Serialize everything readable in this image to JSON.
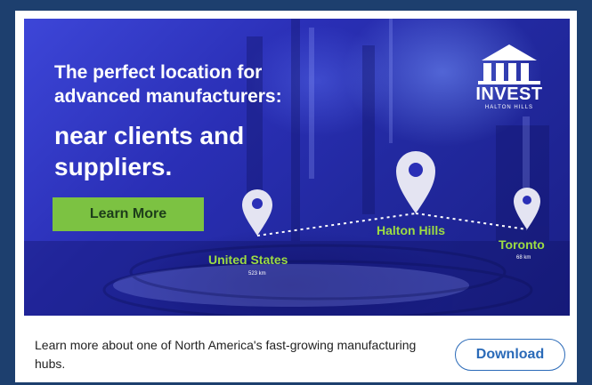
{
  "ad": {
    "headline_line1": "The perfect location for",
    "headline_line2": "advanced manufacturers:",
    "headline_big_line1": "near clients and",
    "headline_big_line2": "suppliers.",
    "learn_more_label": "Learn More",
    "logo_text": "INVEST",
    "logo_subtext": "HALTON HILLS",
    "locations": [
      {
        "name": "United States",
        "distance": "523 km"
      },
      {
        "name": "Halton Hills",
        "distance": ""
      },
      {
        "name": "Toronto",
        "distance": "68 km"
      }
    ],
    "colors": {
      "accent_green": "#7cc242",
      "city_green": "#9ddc43",
      "hero_blue": "#2a2fb6",
      "link_blue": "#2a6ab8",
      "frame_navy": "#1d3f6e"
    }
  },
  "footer": {
    "description": "Learn more about one of North America's fast-growing manufacturing hubs.",
    "download_label": "Download"
  }
}
